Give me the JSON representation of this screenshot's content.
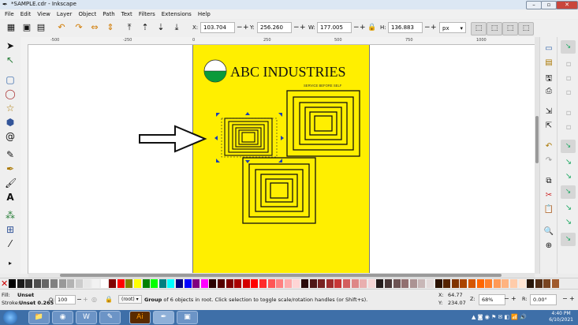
{
  "window": {
    "title": "*SAMPLE.cdr - Inkscape"
  },
  "menu": [
    "File",
    "Edit",
    "View",
    "Layer",
    "Object",
    "Path",
    "Text",
    "Filters",
    "Extensions",
    "Help"
  ],
  "toolbar": {
    "x_label": "X:",
    "x_value": "103.704",
    "y_label": "Y:",
    "y_value": "256.260",
    "w_label": "W:",
    "w_value": "177.005",
    "h_label": "H:",
    "h_value": "136.883",
    "unit": "px"
  },
  "ruler_top": [
    "-500",
    "-250",
    "0",
    "250",
    "500",
    "750",
    "1000"
  ],
  "canvas_doc": {
    "company": "ABC INDUSTRIES",
    "tagline": "SERVICE BEFORE SELF",
    "logo_top_color": "#ffffff",
    "logo_bottom_color": "#0b9a3a",
    "page_color": "#ffef00"
  },
  "palette": [
    "#000000",
    "#1a1a1a",
    "#333333",
    "#4d4d4d",
    "#666666",
    "#808080",
    "#999999",
    "#b3b3b3",
    "#cccccc",
    "#e6e6e6",
    "#f2f2f2",
    "#ffffff",
    "#800000",
    "#ff0000",
    "#808000",
    "#ffff00",
    "#008000",
    "#00ff00",
    "#008080",
    "#00ffff",
    "#000080",
    "#0000ff",
    "#800080",
    "#ff00ff",
    "#2b0000",
    "#550000",
    "#800000",
    "#aa0000",
    "#d40000",
    "#ff0000",
    "#ff2a2a",
    "#ff5555",
    "#ff8080",
    "#ffaaaa",
    "#ffd5d5",
    "#280b0b",
    "#501616",
    "#782121",
    "#a02c2c",
    "#c83737",
    "#d35f5f",
    "#de8787",
    "#e9afaf",
    "#f4d7d7",
    "#241c1c",
    "#483737",
    "#6c5353",
    "#916f6f",
    "#ac9393",
    "#c8b7b7",
    "#e3dbdb",
    "#2b1100",
    "#552200",
    "#803300",
    "#aa4400",
    "#d45500",
    "#ff6600",
    "#ff7f2a",
    "#ff9955",
    "#ffb380",
    "#ffccaa",
    "#ffe6d5",
    "#28170b",
    "#502d16",
    "#784421",
    "#a05a2c"
  ],
  "status": {
    "fill_label": "Fill:",
    "fill_value": "Unset",
    "stroke_label": "Stroke:",
    "stroke_value": "Unset 0.265",
    "opacity_label": "O:",
    "opacity_value": "100",
    "layer_value": "(root)",
    "message_bold": "Group",
    "message_rest": " of 6 objects in root. Click selection to toggle scale/rotation handles (or Shift+s).",
    "x_label": "X:",
    "x_value": "64.77",
    "y_label": "Y:",
    "y_value": "234.07",
    "z_label": "Z:",
    "zoom_value": "68%",
    "r_label": "R:",
    "rotation_value": "0.00°"
  },
  "taskbar": {
    "time": "4:40 PM",
    "date": "6/10/2021",
    "apps": [
      "windows-explorer",
      "chrome",
      "word",
      "paint",
      "illustrator",
      "inkscape",
      "image-viewer"
    ]
  }
}
